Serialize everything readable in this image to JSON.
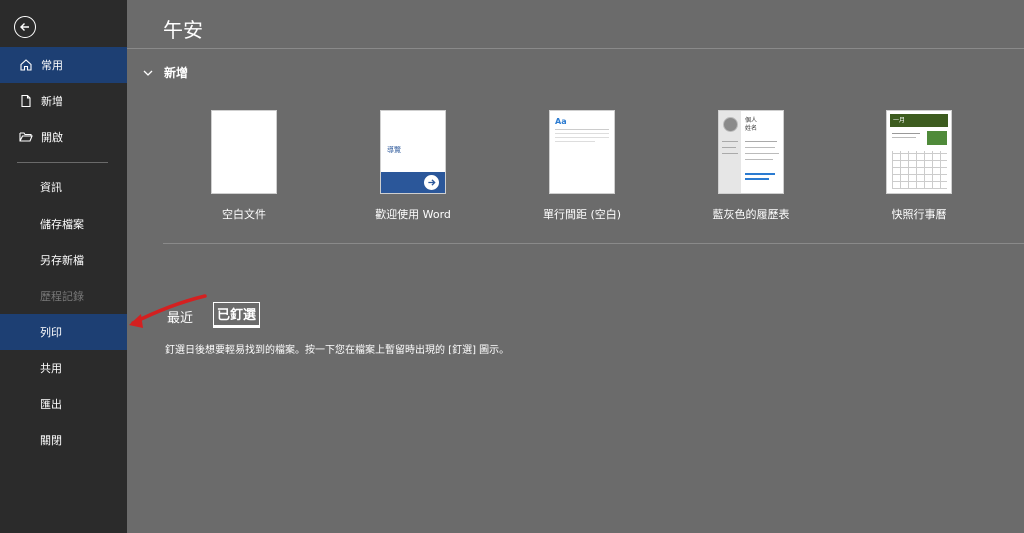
{
  "sidebar": {
    "items": [
      {
        "label": "常用",
        "icon": "home-icon"
      },
      {
        "label": "新增",
        "icon": "new-doc-icon"
      },
      {
        "label": "開啟",
        "icon": "folder-open-icon"
      },
      {
        "label": "資訊"
      },
      {
        "label": "儲存檔案"
      },
      {
        "label": "另存新檔"
      },
      {
        "label": "歷程記錄"
      },
      {
        "label": "列印"
      },
      {
        "label": "共用"
      },
      {
        "label": "匯出"
      },
      {
        "label": "關閉"
      }
    ]
  },
  "main": {
    "greeting": "午安",
    "new_section": "新增",
    "templates": [
      {
        "label": "空白文件"
      },
      {
        "label": "歡迎使用 Word",
        "thumb_text": "導覽"
      },
      {
        "label": "單行間距 (空白)",
        "thumb_text": "Aa"
      },
      {
        "label": "藍灰色的履歷表",
        "thumb_text_1": "個人",
        "thumb_text_2": "姓名"
      },
      {
        "label": "快照行事曆",
        "thumb_text": "一月"
      }
    ],
    "tabs": [
      {
        "label": "最近"
      },
      {
        "label": "已釘選"
      }
    ],
    "pinned_message": "釘選日後想要輕易找到的檔案。按一下您在檔案上暫留時出現的 [釘選] 圖示。"
  },
  "colors": {
    "sidebar_bg": "#2b2b2b",
    "main_bg": "#6b6b6b",
    "active_nav": "#1d3f73",
    "accent_blue": "#2b579a",
    "arrow_red": "#d42020"
  }
}
